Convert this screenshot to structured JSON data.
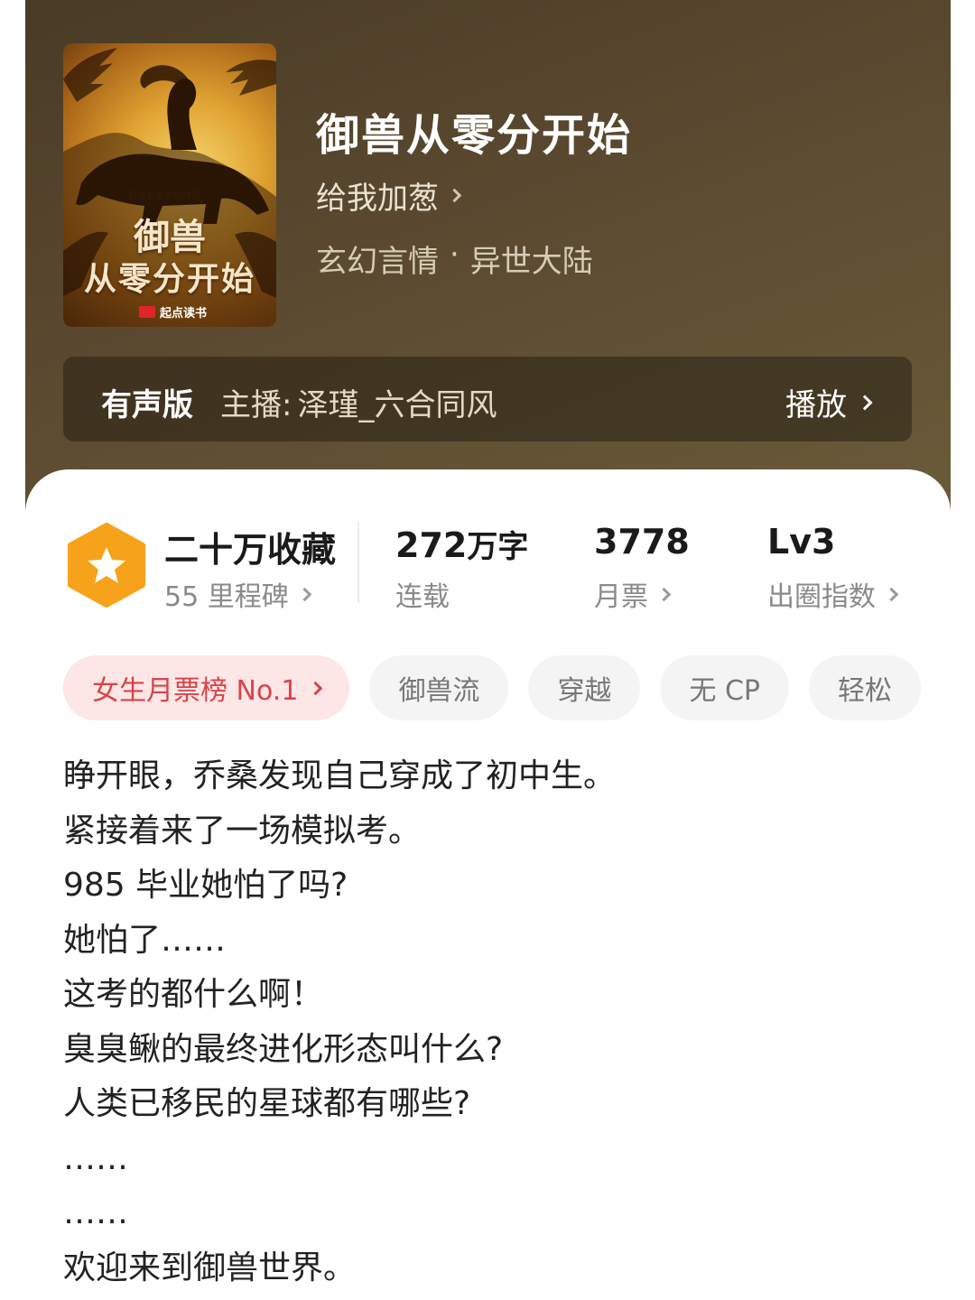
{
  "book": {
    "title": "御兽从零分开始",
    "author": "给我加葱",
    "genre": "玄幻言情",
    "subgenre": "异世大陆",
    "cover": {
      "title_line1": "御兽",
      "title_line2": "从零分开始",
      "series_text": "起点女生原创作品",
      "publisher": "起点读书"
    }
  },
  "audio": {
    "label": "有声版",
    "host_label": "主播:",
    "host_name": "泽瑾_六合同风",
    "play_label": "播放"
  },
  "stats": {
    "collections": "二十万收藏",
    "milestones": "55 里程碑",
    "word_count": "272",
    "word_unit": "万字",
    "status": "连载",
    "monthly_tickets": "3778",
    "monthly_label": "月票",
    "level": "Lv3",
    "level_label": "出圈指数"
  },
  "tags": [
    {
      "label": "女生月票榜 No.1"
    },
    {
      "label": "御兽流"
    },
    {
      "label": "穿越"
    },
    {
      "label": "无 CP"
    },
    {
      "label": "轻松"
    }
  ],
  "synopsis": [
    "睁开眼，乔桑发现自己穿成了初中生。",
    "紧接着来了一场模拟考。",
    "985 毕业她怕了吗?",
    "她怕了……",
    "这考的都什么啊！",
    "臭臭鳅的最终进化形态叫什么?",
    "人类已移民的星球都有哪些?",
    "……",
    "……",
    "欢迎来到御兽世界。"
  ],
  "colors": {
    "hero_bg": "#5b4a30",
    "hot_tag_bg": "#fde6e6",
    "hot_tag_text": "#d8444a",
    "hex_badge": "#f7a21b"
  }
}
